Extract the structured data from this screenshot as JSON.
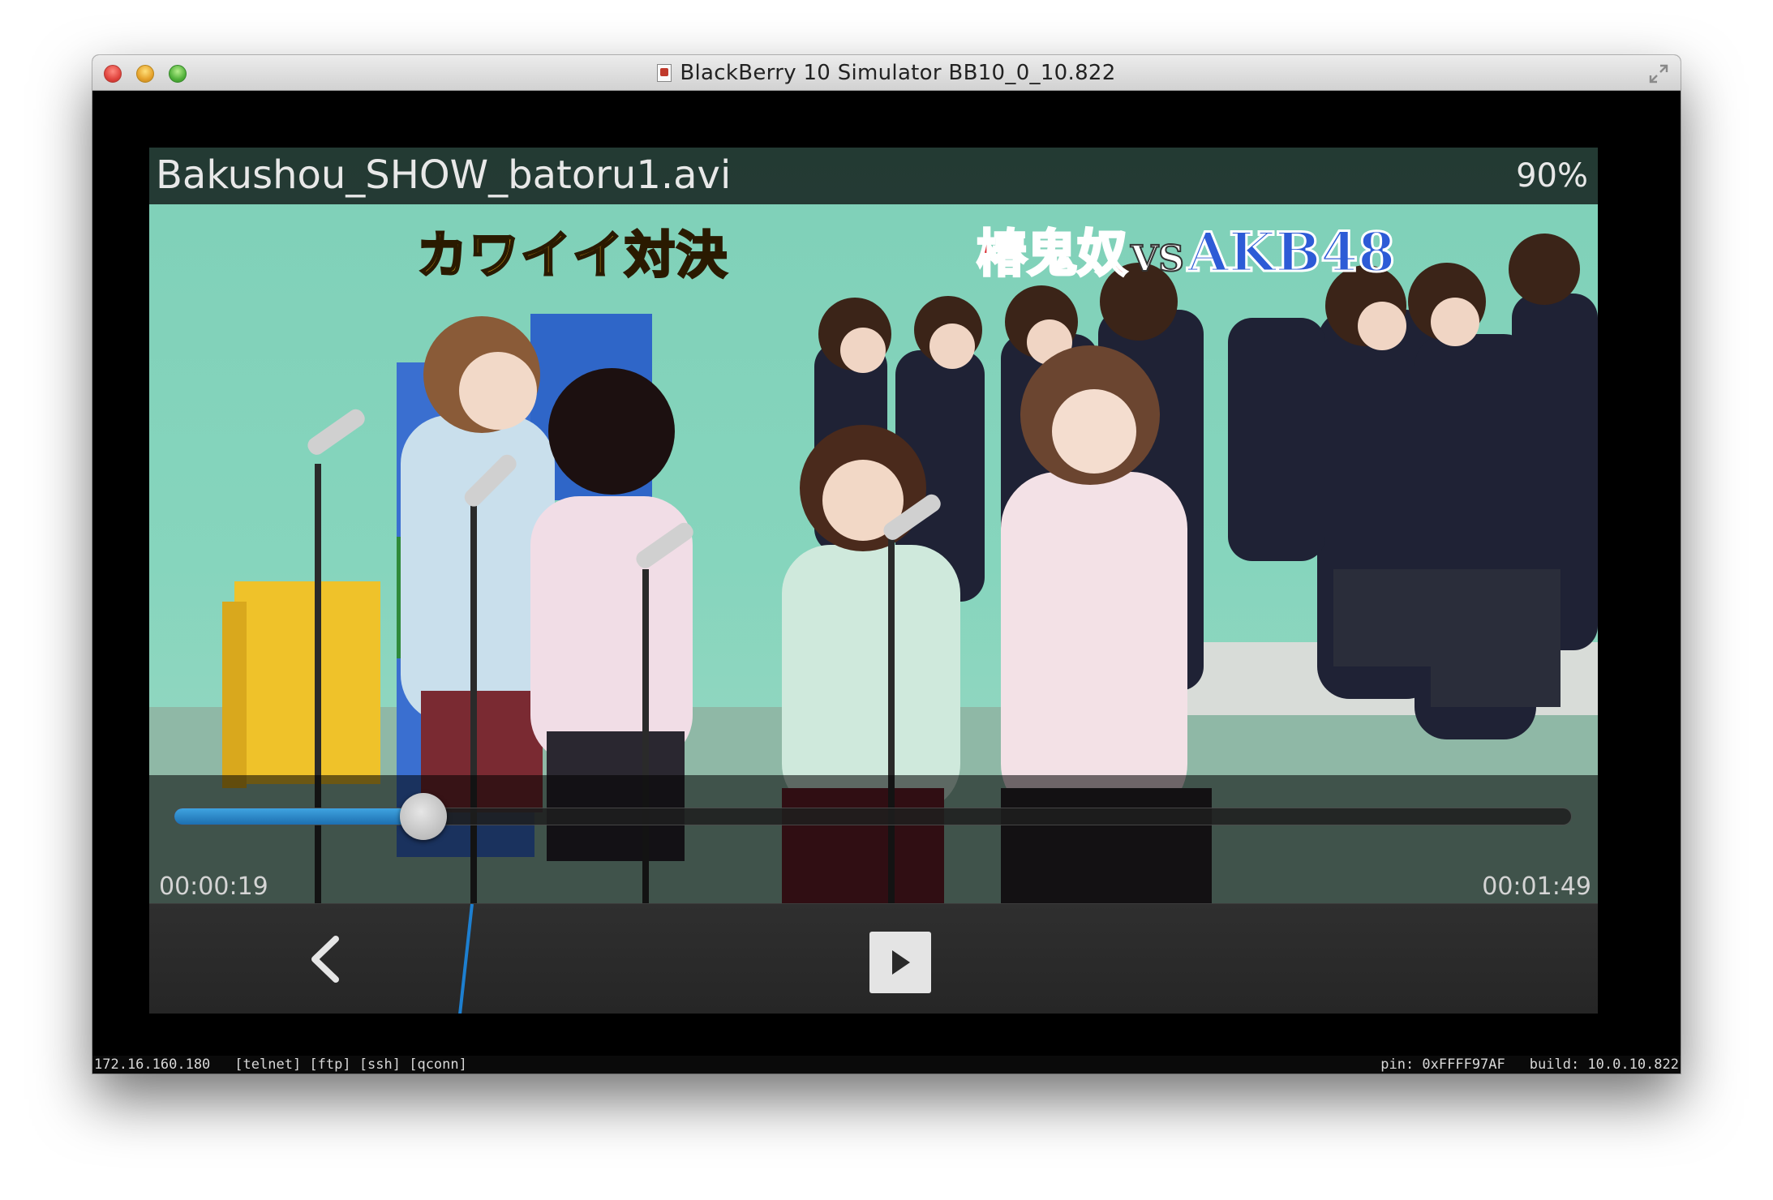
{
  "window": {
    "title": "BlackBerry 10 Simulator BB10_0_10.822"
  },
  "player": {
    "filename": "Bakushou_SHOW_batoru1.avi",
    "battery": "90%",
    "caption_left": "カワイイ対決",
    "caption_right_a": "椿鬼奴",
    "caption_right_b": "VS",
    "caption_right_c": "AKB48",
    "current_time": "00:00:19",
    "duration": "00:01:49",
    "progress": 0.178
  },
  "status_bar": {
    "ip": "172.16.160.180",
    "services": "[telnet] [ftp] [ssh] [qconn]",
    "pin": "pin: 0xFFFF97AF",
    "build": "build: 10.0.10.822"
  },
  "colors": {
    "accent": "#1d6fb0",
    "screen_bg": "#86d5bd"
  },
  "icons": {
    "back": "chevron-left-icon",
    "play": "play-icon",
    "resize": "fullscreen-icon"
  }
}
